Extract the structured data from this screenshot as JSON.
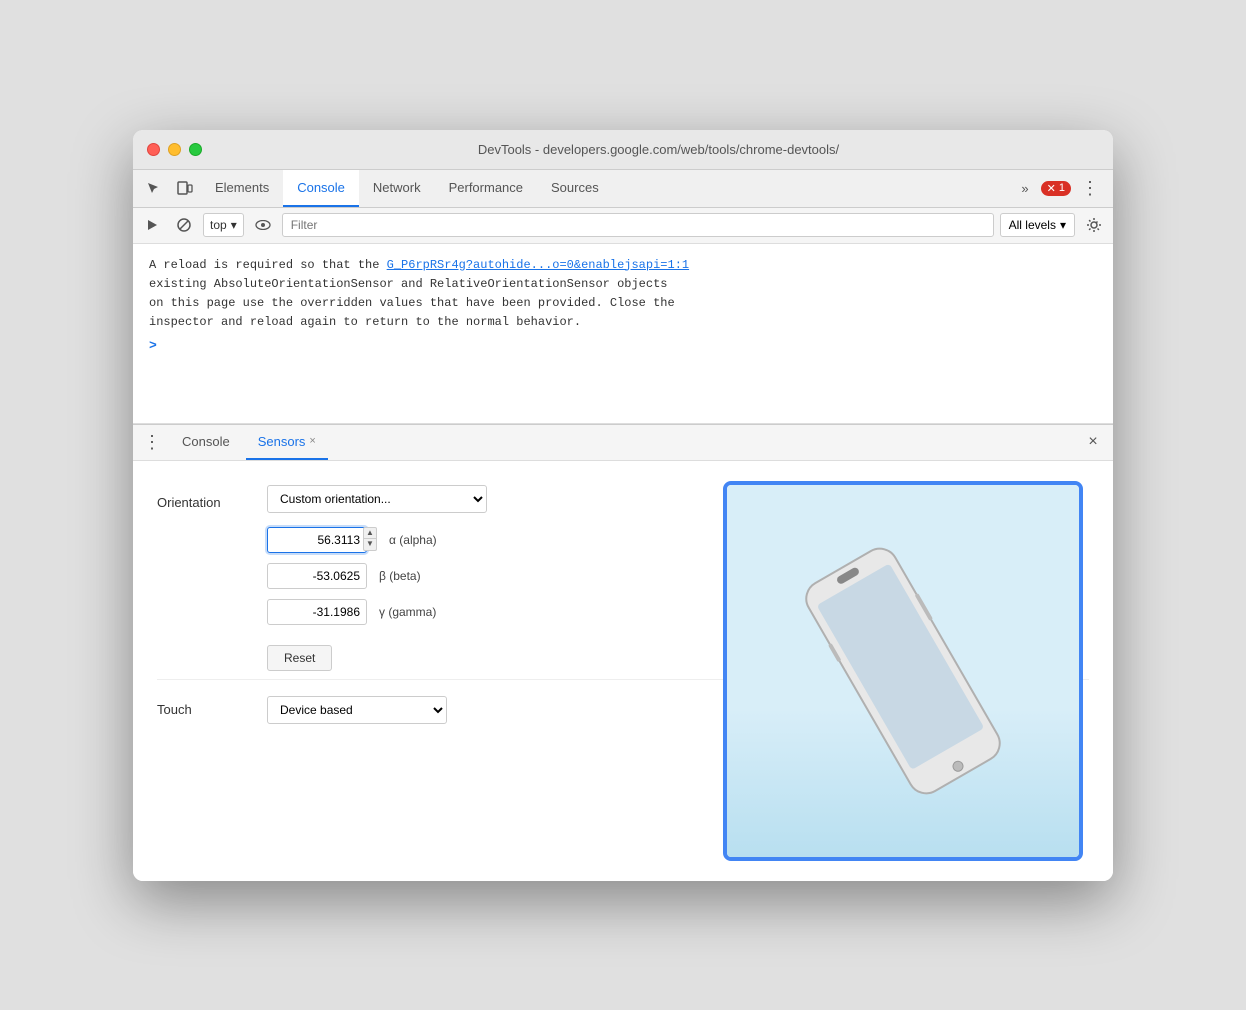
{
  "window": {
    "title": "DevTools - developers.google.com/web/tools/chrome-devtools/"
  },
  "tabs": [
    {
      "id": "elements",
      "label": "Elements",
      "active": false
    },
    {
      "id": "console",
      "label": "Console",
      "active": true
    },
    {
      "id": "network",
      "label": "Network",
      "active": false
    },
    {
      "id": "performance",
      "label": "Performance",
      "active": false
    },
    {
      "id": "sources",
      "label": "Sources",
      "active": false
    }
  ],
  "toolbar": {
    "context": "top",
    "filter_placeholder": "Filter",
    "levels_label": "All levels",
    "error_count": "1"
  },
  "console": {
    "message_line1": "A reload is required so that the",
    "link_text": "G_P6rpRSr4g?autohide...o=0&enablejsapi=1:1",
    "message_line2": "existing AbsoluteOrientationSensor and RelativeOrientationSensor objects",
    "message_line3": "on this page use the overridden values that have been provided. Close the",
    "message_line4": "inspector and reload again to return to the normal behavior.",
    "prompt": ">"
  },
  "bottom_panel": {
    "tabs": [
      {
        "id": "console",
        "label": "Console",
        "active": false,
        "closeable": false
      },
      {
        "id": "sensors",
        "label": "Sensors",
        "active": true,
        "closeable": true
      }
    ],
    "close_label": "×"
  },
  "sensors": {
    "orientation_label": "Orientation",
    "orientation_dropdown": "Custom orientation...",
    "alpha_value": "56.3113",
    "alpha_label": "α (alpha)",
    "beta_value": "-53.0625",
    "beta_label": "β (beta)",
    "gamma_value": "-31.1986",
    "gamma_label": "γ (gamma)",
    "reset_label": "Reset",
    "touch_label": "Touch",
    "touch_dropdown": "Device based"
  }
}
